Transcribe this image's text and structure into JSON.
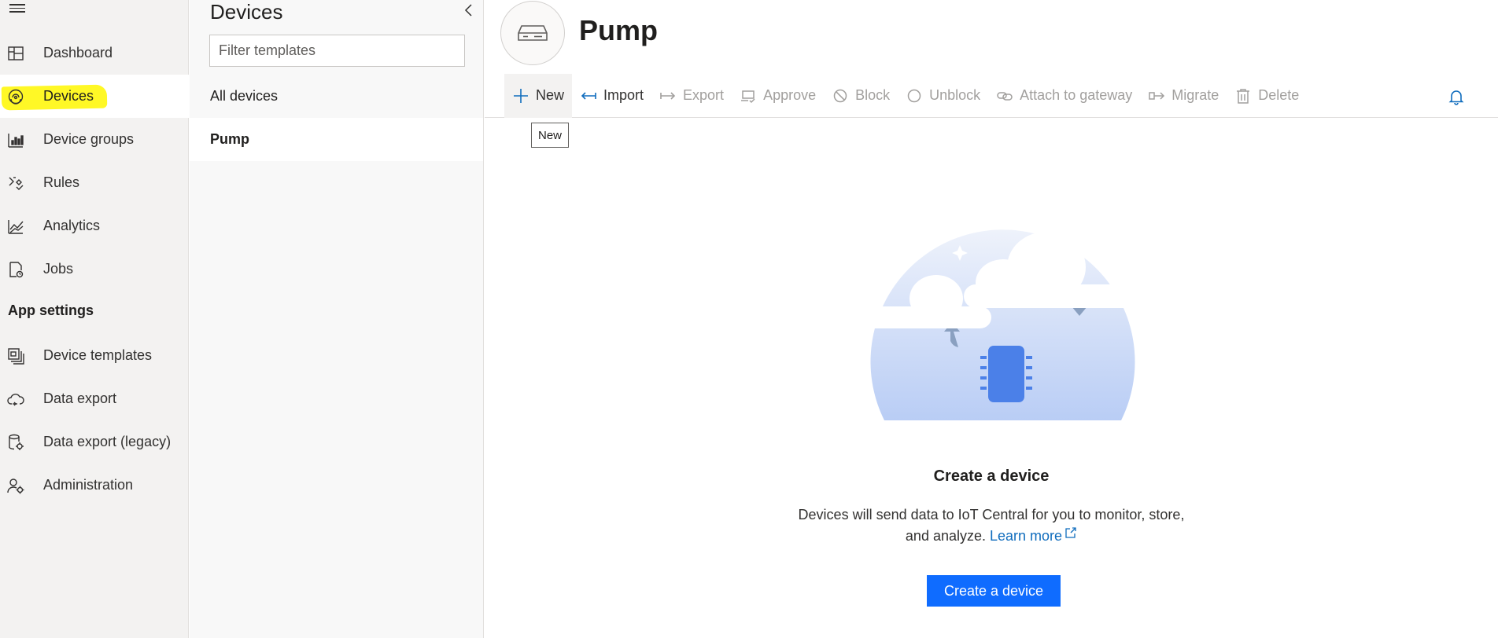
{
  "nav": {
    "items": [
      {
        "label": "Dashboard",
        "icon": "dashboard-icon"
      },
      {
        "label": "Devices",
        "icon": "devices-icon",
        "active": true
      },
      {
        "label": "Device groups",
        "icon": "device-groups-icon"
      },
      {
        "label": "Rules",
        "icon": "rules-icon"
      },
      {
        "label": "Analytics",
        "icon": "analytics-icon"
      },
      {
        "label": "Jobs",
        "icon": "jobs-icon"
      }
    ],
    "section_title": "App settings",
    "settings_items": [
      {
        "label": "Device templates",
        "icon": "device-templates-icon"
      },
      {
        "label": "Data export",
        "icon": "data-export-icon"
      },
      {
        "label": "Data export (legacy)",
        "icon": "data-export-legacy-icon"
      },
      {
        "label": "Administration",
        "icon": "administration-icon"
      }
    ],
    "highlight_color": "#fff700"
  },
  "templates_panel": {
    "title": "Devices",
    "filter_placeholder": "Filter templates",
    "items": [
      {
        "label": "All devices"
      },
      {
        "label": "Pump",
        "selected": true
      }
    ]
  },
  "main": {
    "title": "Pump",
    "toolbar": {
      "new": "New",
      "import": "Import",
      "export": "Export",
      "approve": "Approve",
      "block": "Block",
      "unblock": "Unblock",
      "attach": "Attach to gateway",
      "migrate": "Migrate",
      "delete": "Delete"
    },
    "tooltip": "New",
    "empty_state": {
      "title": "Create a device",
      "desc_line1": "Devices will send data to IoT Central for you to monitor, store,",
      "desc_line2_prefix": "and analyze.",
      "learn_more": "Learn more",
      "button": "Create a device"
    }
  },
  "colors": {
    "accent": "#0f6cff",
    "link": "#0f6cbd",
    "nav_bg": "#f3f2f1",
    "disabled_text": "#a19f9d"
  }
}
